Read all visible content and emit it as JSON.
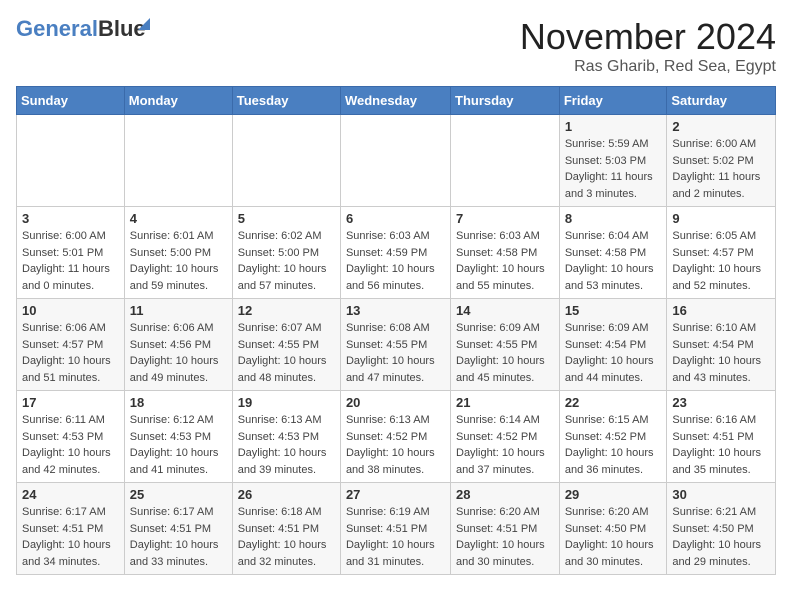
{
  "logo": {
    "part1": "General",
    "part2": "Blue"
  },
  "title": "November 2024",
  "location": "Ras Gharib, Red Sea, Egypt",
  "weekdays": [
    "Sunday",
    "Monday",
    "Tuesday",
    "Wednesday",
    "Thursday",
    "Friday",
    "Saturday"
  ],
  "weeks": [
    [
      {
        "day": "",
        "sunrise": "",
        "sunset": "",
        "daylight": ""
      },
      {
        "day": "",
        "sunrise": "",
        "sunset": "",
        "daylight": ""
      },
      {
        "day": "",
        "sunrise": "",
        "sunset": "",
        "daylight": ""
      },
      {
        "day": "",
        "sunrise": "",
        "sunset": "",
        "daylight": ""
      },
      {
        "day": "",
        "sunrise": "",
        "sunset": "",
        "daylight": ""
      },
      {
        "day": "1",
        "sunrise": "Sunrise: 5:59 AM",
        "sunset": "Sunset: 5:03 PM",
        "daylight": "Daylight: 11 hours and 3 minutes."
      },
      {
        "day": "2",
        "sunrise": "Sunrise: 6:00 AM",
        "sunset": "Sunset: 5:02 PM",
        "daylight": "Daylight: 11 hours and 2 minutes."
      }
    ],
    [
      {
        "day": "3",
        "sunrise": "Sunrise: 6:00 AM",
        "sunset": "Sunset: 5:01 PM",
        "daylight": "Daylight: 11 hours and 0 minutes."
      },
      {
        "day": "4",
        "sunrise": "Sunrise: 6:01 AM",
        "sunset": "Sunset: 5:00 PM",
        "daylight": "Daylight: 10 hours and 59 minutes."
      },
      {
        "day": "5",
        "sunrise": "Sunrise: 6:02 AM",
        "sunset": "Sunset: 5:00 PM",
        "daylight": "Daylight: 10 hours and 57 minutes."
      },
      {
        "day": "6",
        "sunrise": "Sunrise: 6:03 AM",
        "sunset": "Sunset: 4:59 PM",
        "daylight": "Daylight: 10 hours and 56 minutes."
      },
      {
        "day": "7",
        "sunrise": "Sunrise: 6:03 AM",
        "sunset": "Sunset: 4:58 PM",
        "daylight": "Daylight: 10 hours and 55 minutes."
      },
      {
        "day": "8",
        "sunrise": "Sunrise: 6:04 AM",
        "sunset": "Sunset: 4:58 PM",
        "daylight": "Daylight: 10 hours and 53 minutes."
      },
      {
        "day": "9",
        "sunrise": "Sunrise: 6:05 AM",
        "sunset": "Sunset: 4:57 PM",
        "daylight": "Daylight: 10 hours and 52 minutes."
      }
    ],
    [
      {
        "day": "10",
        "sunrise": "Sunrise: 6:06 AM",
        "sunset": "Sunset: 4:57 PM",
        "daylight": "Daylight: 10 hours and 51 minutes."
      },
      {
        "day": "11",
        "sunrise": "Sunrise: 6:06 AM",
        "sunset": "Sunset: 4:56 PM",
        "daylight": "Daylight: 10 hours and 49 minutes."
      },
      {
        "day": "12",
        "sunrise": "Sunrise: 6:07 AM",
        "sunset": "Sunset: 4:55 PM",
        "daylight": "Daylight: 10 hours and 48 minutes."
      },
      {
        "day": "13",
        "sunrise": "Sunrise: 6:08 AM",
        "sunset": "Sunset: 4:55 PM",
        "daylight": "Daylight: 10 hours and 47 minutes."
      },
      {
        "day": "14",
        "sunrise": "Sunrise: 6:09 AM",
        "sunset": "Sunset: 4:55 PM",
        "daylight": "Daylight: 10 hours and 45 minutes."
      },
      {
        "day": "15",
        "sunrise": "Sunrise: 6:09 AM",
        "sunset": "Sunset: 4:54 PM",
        "daylight": "Daylight: 10 hours and 44 minutes."
      },
      {
        "day": "16",
        "sunrise": "Sunrise: 6:10 AM",
        "sunset": "Sunset: 4:54 PM",
        "daylight": "Daylight: 10 hours and 43 minutes."
      }
    ],
    [
      {
        "day": "17",
        "sunrise": "Sunrise: 6:11 AM",
        "sunset": "Sunset: 4:53 PM",
        "daylight": "Daylight: 10 hours and 42 minutes."
      },
      {
        "day": "18",
        "sunrise": "Sunrise: 6:12 AM",
        "sunset": "Sunset: 4:53 PM",
        "daylight": "Daylight: 10 hours and 41 minutes."
      },
      {
        "day": "19",
        "sunrise": "Sunrise: 6:13 AM",
        "sunset": "Sunset: 4:53 PM",
        "daylight": "Daylight: 10 hours and 39 minutes."
      },
      {
        "day": "20",
        "sunrise": "Sunrise: 6:13 AM",
        "sunset": "Sunset: 4:52 PM",
        "daylight": "Daylight: 10 hours and 38 minutes."
      },
      {
        "day": "21",
        "sunrise": "Sunrise: 6:14 AM",
        "sunset": "Sunset: 4:52 PM",
        "daylight": "Daylight: 10 hours and 37 minutes."
      },
      {
        "day": "22",
        "sunrise": "Sunrise: 6:15 AM",
        "sunset": "Sunset: 4:52 PM",
        "daylight": "Daylight: 10 hours and 36 minutes."
      },
      {
        "day": "23",
        "sunrise": "Sunrise: 6:16 AM",
        "sunset": "Sunset: 4:51 PM",
        "daylight": "Daylight: 10 hours and 35 minutes."
      }
    ],
    [
      {
        "day": "24",
        "sunrise": "Sunrise: 6:17 AM",
        "sunset": "Sunset: 4:51 PM",
        "daylight": "Daylight: 10 hours and 34 minutes."
      },
      {
        "day": "25",
        "sunrise": "Sunrise: 6:17 AM",
        "sunset": "Sunset: 4:51 PM",
        "daylight": "Daylight: 10 hours and 33 minutes."
      },
      {
        "day": "26",
        "sunrise": "Sunrise: 6:18 AM",
        "sunset": "Sunset: 4:51 PM",
        "daylight": "Daylight: 10 hours and 32 minutes."
      },
      {
        "day": "27",
        "sunrise": "Sunrise: 6:19 AM",
        "sunset": "Sunset: 4:51 PM",
        "daylight": "Daylight: 10 hours and 31 minutes."
      },
      {
        "day": "28",
        "sunrise": "Sunrise: 6:20 AM",
        "sunset": "Sunset: 4:51 PM",
        "daylight": "Daylight: 10 hours and 30 minutes."
      },
      {
        "day": "29",
        "sunrise": "Sunrise: 6:20 AM",
        "sunset": "Sunset: 4:50 PM",
        "daylight": "Daylight: 10 hours and 30 minutes."
      },
      {
        "day": "30",
        "sunrise": "Sunrise: 6:21 AM",
        "sunset": "Sunset: 4:50 PM",
        "daylight": "Daylight: 10 hours and 29 minutes."
      }
    ]
  ]
}
